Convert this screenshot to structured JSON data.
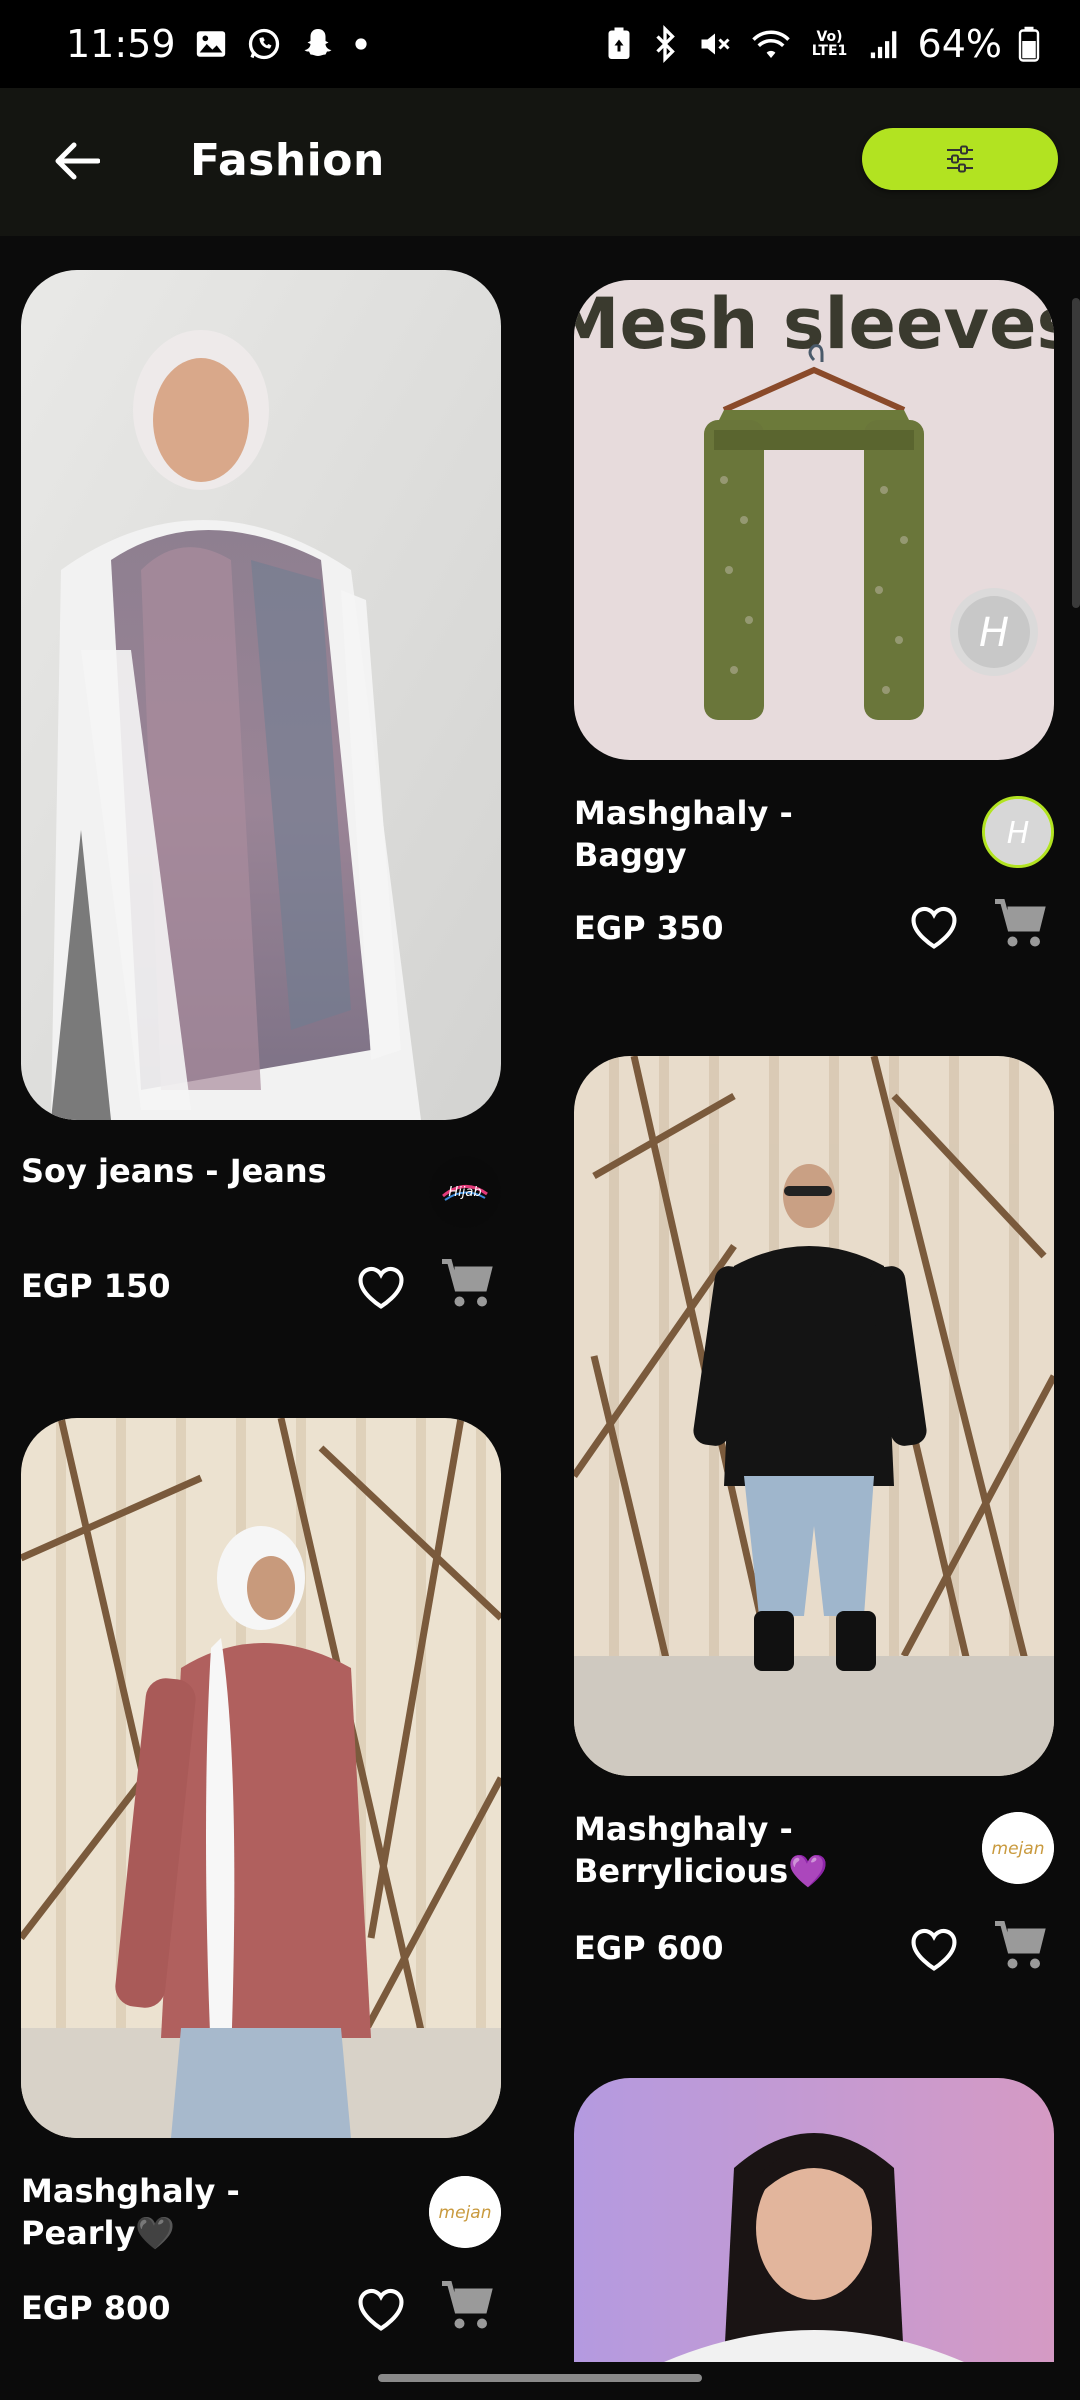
{
  "status_bar": {
    "time": "11:59",
    "battery": "64%",
    "network_label": "Vo) LTE1"
  },
  "header": {
    "title": "Fashion",
    "back_icon": "arrow-left-icon",
    "filter_icon": "sliders-icon"
  },
  "colors": {
    "accent": "#b2e321",
    "background": "#0b0b0b",
    "header_bg": "#141511"
  },
  "products": [
    {
      "name": "Soy jeans - Jeans",
      "price": "EGP 150",
      "logo_text": "Hijab"
    },
    {
      "name": "Mashghaly - Baggy",
      "price": "EGP 350",
      "image_text": "Mesh sleeves",
      "logo_text": "H"
    },
    {
      "name": "Mashghaly - Berrylicious💜",
      "price": "EGP 600",
      "logo_text": "mejan"
    },
    {
      "name": "Mashghaly - Pearly🖤",
      "price": "EGP 800",
      "logo_text": "mejan"
    }
  ]
}
